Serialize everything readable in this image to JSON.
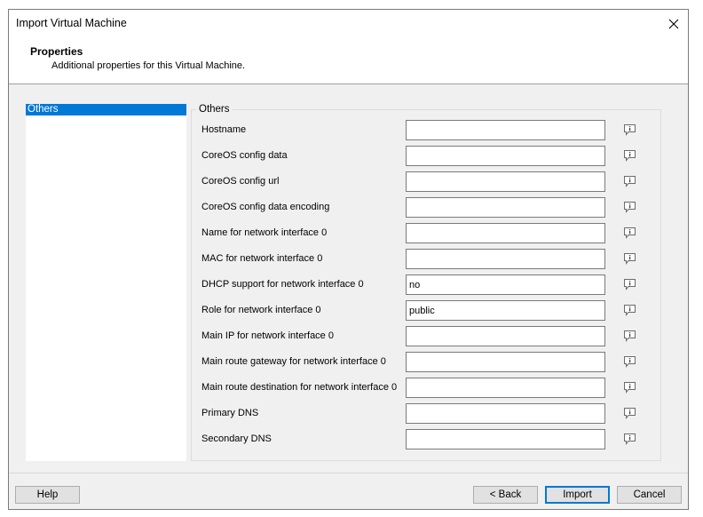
{
  "window": {
    "title": "Import Virtual Machine"
  },
  "header": {
    "title": "Properties",
    "description": "Additional properties for this Virtual Machine."
  },
  "sidebar": {
    "items": [
      {
        "label": "Others",
        "selected": true
      }
    ]
  },
  "group": {
    "title": "Others",
    "fields": [
      {
        "label": "Hostname",
        "value": ""
      },
      {
        "label": "CoreOS config data",
        "value": ""
      },
      {
        "label": "CoreOS config url",
        "value": ""
      },
      {
        "label": "CoreOS config data encoding",
        "value": ""
      },
      {
        "label": "Name for network interface 0",
        "value": ""
      },
      {
        "label": "MAC for network interface 0",
        "value": ""
      },
      {
        "label": "DHCP support for network interface 0",
        "value": "no"
      },
      {
        "label": "Role for network interface 0",
        "value": "public"
      },
      {
        "label": "Main IP for network interface 0",
        "value": ""
      },
      {
        "label": "Main route gateway for network interface 0",
        "value": ""
      },
      {
        "label": "Main route destination for network interface 0",
        "value": ""
      },
      {
        "label": "Primary DNS",
        "value": ""
      },
      {
        "label": "Secondary DNS",
        "value": ""
      }
    ]
  },
  "buttons": {
    "help": "Help",
    "back": "< Back",
    "import": "Import",
    "cancel": "Cancel"
  },
  "colors": {
    "selection": "#0078d7",
    "dialog_bg": "#f0f0f0"
  },
  "icons": {
    "close": "close-icon",
    "info": "info-balloon-icon"
  }
}
